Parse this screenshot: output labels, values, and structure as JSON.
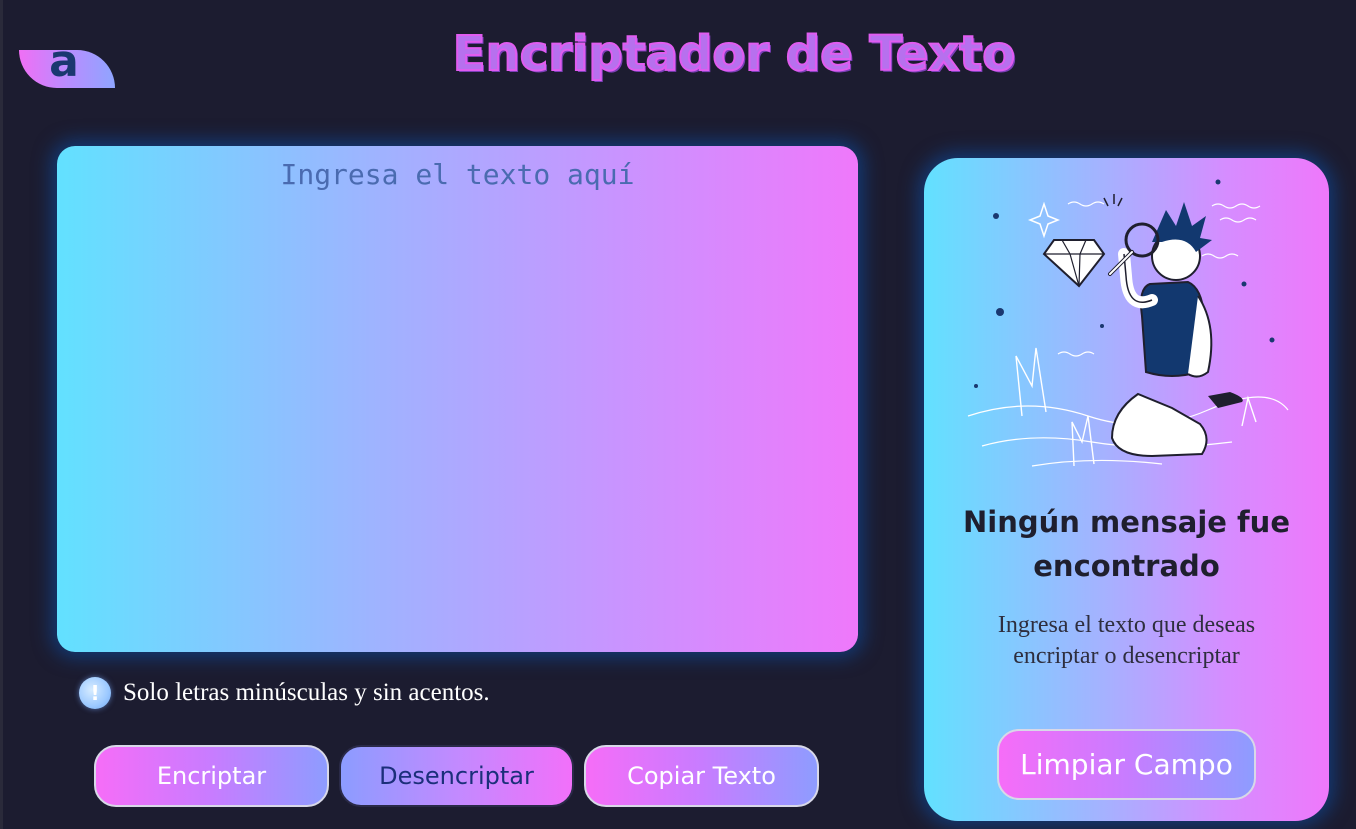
{
  "header": {
    "logo_letter": "a",
    "title": "Encriptador de Texto"
  },
  "input": {
    "placeholder": "Ingresa el texto aquí",
    "value": ""
  },
  "hint": {
    "icon": "info-icon",
    "icon_glyph": "!",
    "text": "Solo letras minúsculas y sin acentos."
  },
  "buttons": {
    "encrypt": "Encriptar",
    "decrypt": "Desencriptar",
    "copy": "Copiar Texto",
    "clear": "Limpiar Campo"
  },
  "output": {
    "illustration": "person-with-magnifying-glass-illustration",
    "title": "Ningún mensaje fue encontrado",
    "description": "Ingresa el texto que deseas encriptar o desencriptar"
  },
  "colors": {
    "background": "#1c1c30",
    "gradient_cyan": "#62e1ff",
    "gradient_pink": "#ef78fb",
    "title_purple": "#b770ee",
    "dark_blue": "#1b2f7a"
  }
}
